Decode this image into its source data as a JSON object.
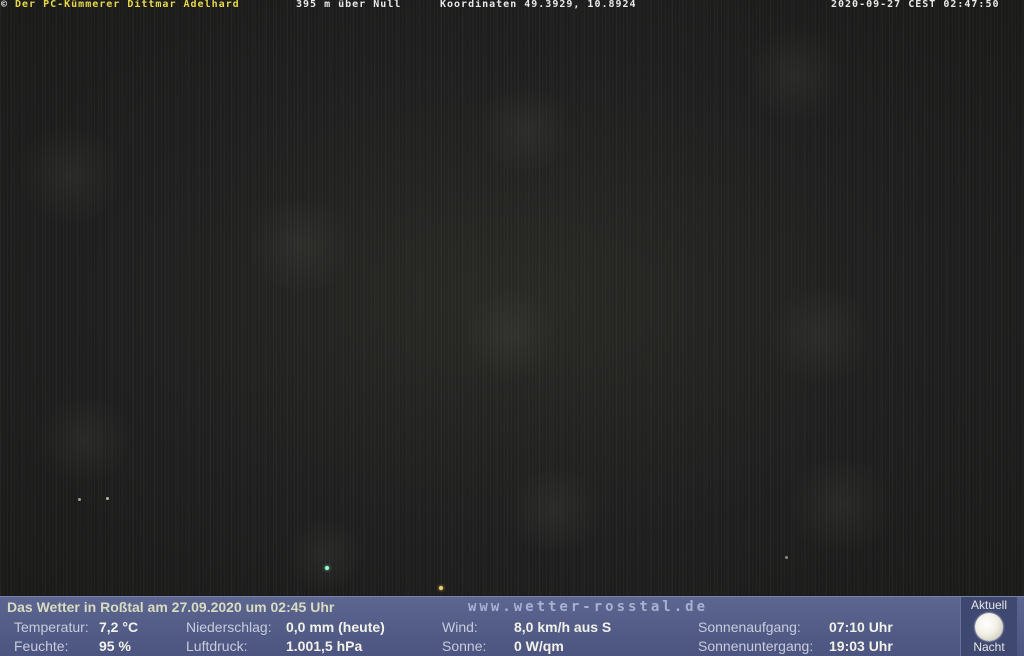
{
  "overlay": {
    "copyright_symbol": "©",
    "owner": "Der PC-Kümmerer Dittmar Adelhard",
    "altitude": "395 m über Null",
    "coordinates": "Koordinaten 49.3929, 10.8924",
    "datetime": "2020-09-27 CEST 02:47:50"
  },
  "weather": {
    "title": "Das Wetter in Roßtal am 27.09.2020 um 02:45 Uhr",
    "website": "www.wetter-rosstal.de",
    "temperature": {
      "label": "Temperatur:",
      "value": "7,2 °C"
    },
    "humidity": {
      "label": "Feuchte:",
      "value": "95 %"
    },
    "precipitation": {
      "label": "Niederschlag:",
      "value": "0,0 mm (heute)"
    },
    "pressure": {
      "label": "Luftdruck:",
      "value": "1.001,5 hPa"
    },
    "wind": {
      "label": "Wind:",
      "value": "8,0 km/h aus S"
    },
    "sun": {
      "label": "Sonne:",
      "value": "0 W/qm"
    },
    "sunrise": {
      "label": "Sonnenaufgang:",
      "value": "07:10 Uhr"
    },
    "sunset": {
      "label": "Sonnenuntergang:",
      "value": "19:03 Uhr"
    },
    "moon": {
      "top_label": "Aktuell",
      "bottom_label": "Nacht",
      "icon": "moon-icon"
    }
  },
  "colors": {
    "overlay_owner": "#e8d84a",
    "panel_background": "#535d88",
    "title_text": "#d8dcc0"
  }
}
